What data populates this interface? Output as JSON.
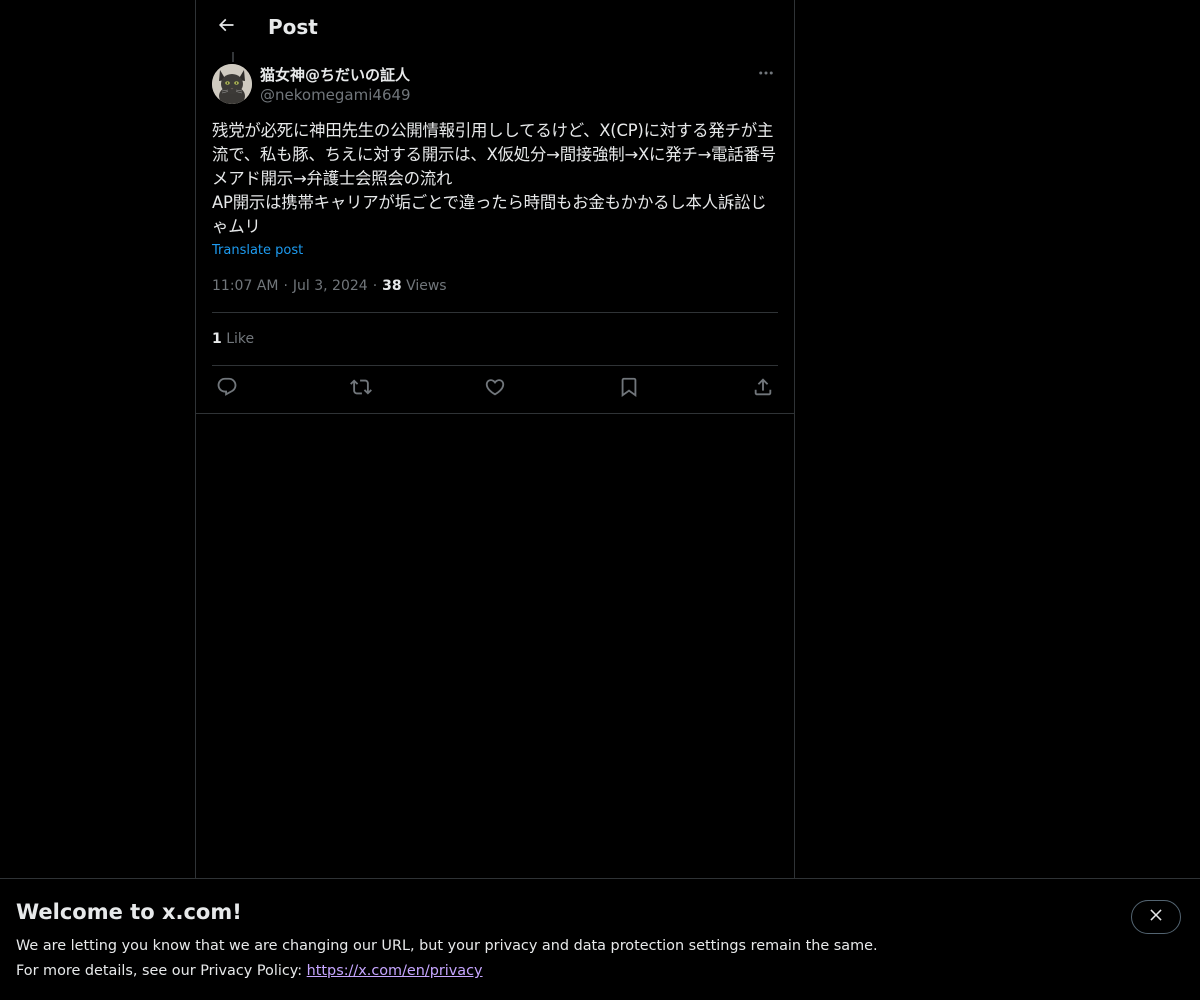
{
  "header": {
    "title": "Post",
    "back_icon": "arrow-left-icon"
  },
  "post": {
    "author": {
      "display_name": "猫女神@ちだいの証人",
      "handle": "@nekomegami4649",
      "avatar_icon": "cat-avatar"
    },
    "more_icon": "more-horizontal-icon",
    "text": "残党が必死に神田先生の公開情報引用ししてるけど、X(CP)に対する発チが主流で、私も豚、ちえに対する開示は、X仮処分→間接強制→Xに発チ→電話番号メアド開示→弁護士会照会の流れ\nAP開示は携帯キャリアが垢ごとで違ったら時間もお金もかかるし本人訴訟じゃムリ",
    "translate_label": "Translate post",
    "time": "11:07 AM",
    "date": "Jul 3, 2024",
    "separator": "·",
    "views_count": "38",
    "views_label": "Views",
    "likes_count": "1",
    "likes_label": "Like",
    "actions": [
      {
        "icon": "reply-icon"
      },
      {
        "icon": "repost-icon"
      },
      {
        "icon": "like-icon"
      },
      {
        "icon": "bookmark-icon"
      },
      {
        "icon": "share-icon"
      }
    ]
  },
  "banner": {
    "title": "Welcome to x.com!",
    "line1": "We are letting you know that we are changing our URL, but your privacy and data protection settings remain the same.",
    "line2_prefix": "For more details, see our Privacy Policy: ",
    "link_text": "https://x.com/en/privacy",
    "close_icon": "close-icon"
  },
  "colors": {
    "background": "#000000",
    "text_primary": "#e7e9ea",
    "text_secondary": "#71767b",
    "accent": "#1d9bf0",
    "border": "#2f3336",
    "link_visited": "#c6a6ff"
  }
}
